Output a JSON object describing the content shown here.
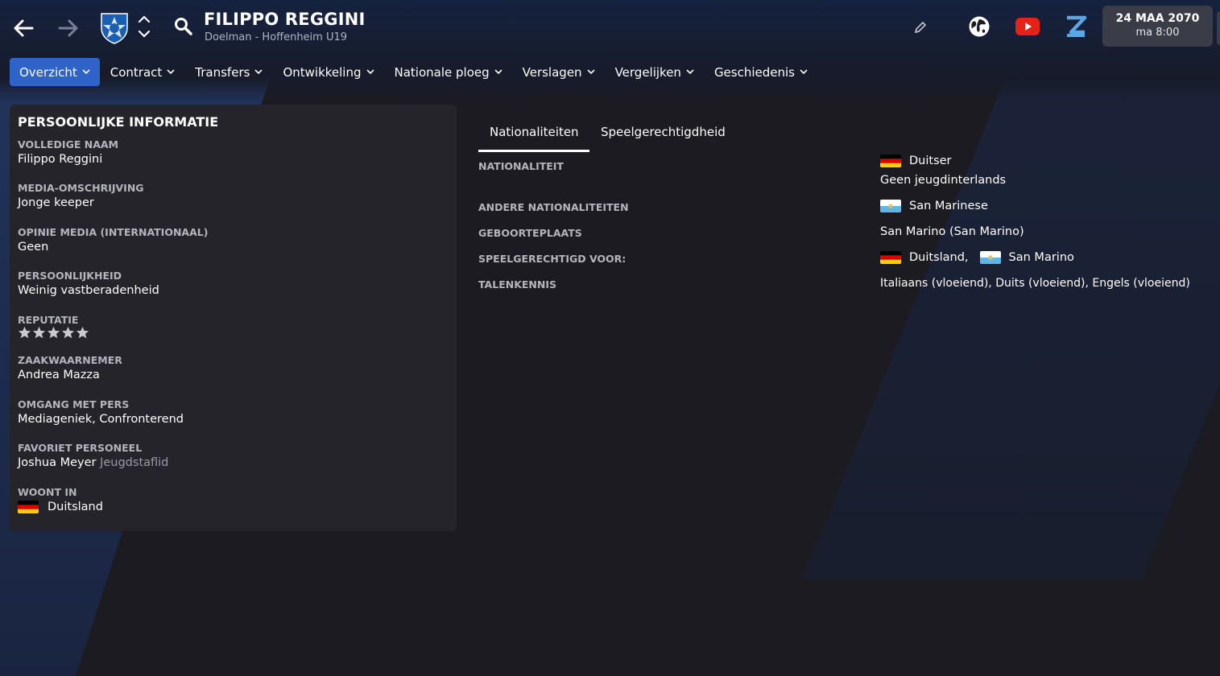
{
  "header": {
    "player_name": "FILIPPO REGGINI",
    "player_subtitle": "Doelman - Hoffenheim U19",
    "date": "24 MAA 2070",
    "time": "ma 8:00"
  },
  "tabs": [
    {
      "label": "Overzicht",
      "active": true
    },
    {
      "label": "Contract"
    },
    {
      "label": "Transfers"
    },
    {
      "label": "Ontwikkeling"
    },
    {
      "label": "Nationale ploeg"
    },
    {
      "label": "Verslagen"
    },
    {
      "label": "Vergelijken"
    },
    {
      "label": "Geschiedenis"
    }
  ],
  "personal": {
    "title": "PERSOONLIJKE INFORMATIE",
    "fields": [
      {
        "label": "VOLLEDIGE NAAM",
        "value": "Filippo Reggini"
      },
      {
        "label": "MEDIA-OMSCHRIJVING",
        "value": "Jonge keeper"
      },
      {
        "label": "OPINIE MEDIA (INTERNATIONAAL)",
        "value": "Geen"
      },
      {
        "label": "PERSOONLIJKHEID",
        "value": "Weinig vastberadenheid"
      },
      {
        "label": "REPUTATIE",
        "stars": 5
      },
      {
        "label": "ZAAKWAARNEMER",
        "value": "Andrea Mazza"
      },
      {
        "label": "OMGANG MET PERS",
        "value": "Mediageniek, Confronterend"
      },
      {
        "label": "FAVORIET PERSONEEL",
        "value": "Joshua Meyer",
        "extra": "Jeugdstaflid"
      },
      {
        "label": "WOONT IN",
        "value": "Duitsland",
        "flag": "germany-flag"
      }
    ]
  },
  "nationality": {
    "subtabs": [
      "Nationaliteiten",
      "Speelgerechtigdheid"
    ],
    "rows": {
      "nationaliteit_label": "NATIONALITEIT",
      "nationaliteit_value": "Duitser",
      "nationaliteit_note": "Geen jeugdinterlands",
      "andere_label": "ANDERE NATIONALITEITEN",
      "andere_value": "San Marinese",
      "geboorte_label": "GEBOORTEPLAATS",
      "geboorte_value": "San Marino (San Marino)",
      "speel_label": "SPEELGERECHTIGD VOOR:",
      "speel_value_1": "Duitsland,",
      "speel_value_2": "San Marino",
      "talen_label": "TALENKENNIS",
      "talen_value": "Italiaans (vloeiend), Duits (vloeiend), Engels (vloeiend)"
    }
  },
  "colors": {
    "accent": "#2f63c8",
    "panel": "#25242b",
    "background": "#1c1b21",
    "label": "#b4b4bc",
    "youtube": "#e62117",
    "z_logo": "#5aa6e6"
  },
  "icons": [
    "back-arrow-icon",
    "forward-arrow-icon",
    "club-crest-icon",
    "chevron-up-icon",
    "chevron-down-icon",
    "search-icon",
    "pencil-icon",
    "globe-icon",
    "youtube-icon",
    "z-logo-icon",
    "star-icon",
    "germany-flag-icon",
    "san-marino-flag-icon"
  ]
}
